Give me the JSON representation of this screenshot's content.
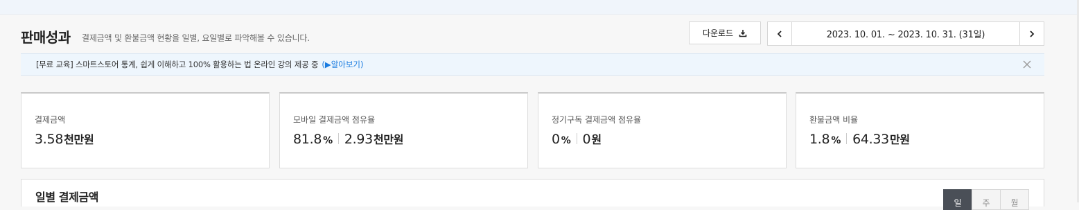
{
  "header": {
    "title": "판매성과",
    "subtitle": "결제금액 및 환불금액 현황을 일별, 요일별로 파악해볼 수 있습니다."
  },
  "toolbar": {
    "download_label": "다운로드",
    "date_range": "2023. 10. 01. ~ 2023. 10. 31. (31일)"
  },
  "notice": {
    "text": "[무료 교육] 스마트스토어 통계, 쉽게 이해하고 100% 활용하는 법 온라인 강의 제공 중",
    "link": "(▶알아보기)"
  },
  "cards": [
    {
      "label": "결제금액",
      "amount": "3.58",
      "amount_unit": "천만원"
    },
    {
      "label": "모바일 결제금액 점유율",
      "pct": "81.8",
      "pct_unit": "%",
      "amount": "2.93",
      "amount_unit": "천만원"
    },
    {
      "label": "정기구독 결제금액 점유율",
      "pct": "0",
      "pct_unit": "%",
      "amount": "0",
      "amount_unit": "원"
    },
    {
      "label": "환불금액 비율",
      "pct": "1.8",
      "pct_unit": "%",
      "amount": "64.33",
      "amount_unit": "만원"
    }
  ],
  "daily": {
    "title": "일별 결제금액",
    "toggles": [
      "일",
      "주",
      "월"
    ],
    "active_toggle": "일"
  },
  "colors": {
    "accent_link": "#1a7ce0",
    "notice_bg": "#eef6fd",
    "toggle_active": "#4a4f57"
  }
}
